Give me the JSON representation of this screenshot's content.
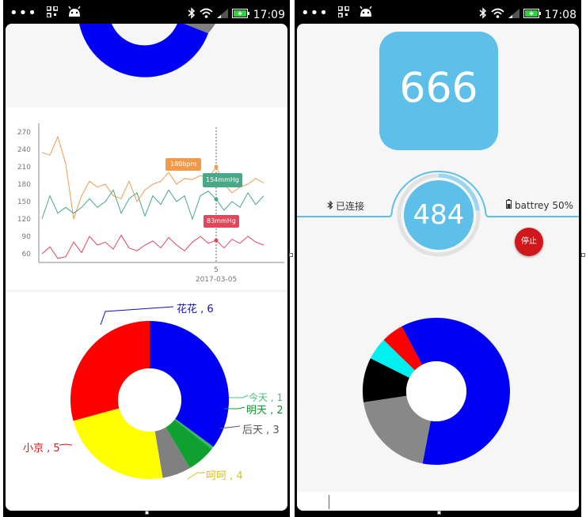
{
  "left_phone": {
    "status": {
      "time": "17:09"
    },
    "line_chart": {
      "y_ticks": [
        "270",
        "240",
        "210",
        "180",
        "150",
        "120",
        "90",
        "60"
      ],
      "x_tick": "5",
      "x_date": "2017-03-05",
      "markers": [
        {
          "label": "180bpm",
          "color": "#f29a4c"
        },
        {
          "label": "154mmHg",
          "color": "#4aa88a"
        },
        {
          "label": "83mmHg",
          "color": "#e0495a"
        }
      ]
    },
    "pie_labels": [
      {
        "text": "花花 , 6",
        "color": "#1010c0"
      },
      {
        "text": "今天 , 1",
        "color": "#3dc47c"
      },
      {
        "text": "明天 , 2",
        "color": "#0a9a2a"
      },
      {
        "text": "后天 , 3",
        "color": "#555555"
      },
      {
        "text": "呵呵 , 4",
        "color": "#d6c21c"
      },
      {
        "text": "小京 , 5",
        "color": "#e01010"
      }
    ]
  },
  "right_phone": {
    "status": {
      "time": "17:08"
    },
    "big_value": "666",
    "gauge_value": "484",
    "connection_text": "已连接",
    "battery_text": "battrey 50%",
    "stop_label": "停止"
  },
  "chart_data": [
    {
      "type": "line",
      "x_tick_labels": [
        "5"
      ],
      "x_date_label": "2017-03-05",
      "ylim": [
        45,
        285
      ],
      "y_ticks": [
        60,
        90,
        120,
        150,
        180,
        210,
        240,
        270
      ],
      "grid": false,
      "series": [
        {
          "color": "#f29a4c",
          "values": [
            235,
            230,
            262,
            215,
            120,
            160,
            185,
            175,
            180,
            160,
            155,
            185,
            150,
            170,
            180,
            185,
            200,
            180,
            190,
            188,
            195,
            190,
            210,
            180,
            165,
            175,
            180,
            190,
            182
          ]
        },
        {
          "color": "#4aa88a",
          "values": [
            120,
            160,
            130,
            140,
            130,
            140,
            155,
            140,
            150,
            170,
            130,
            155,
            165,
            125,
            160,
            145,
            170,
            150,
            160,
            120,
            160,
            168,
            154,
            135,
            150,
            140,
            165,
            145,
            160
          ]
        },
        {
          "color": "#e0495a",
          "values": [
            60,
            72,
            52,
            55,
            80,
            62,
            90,
            75,
            80,
            68,
            92,
            70,
            65,
            75,
            82,
            70,
            88,
            75,
            65,
            80,
            90,
            78,
            83,
            70,
            85,
            78,
            90,
            80,
            75
          ]
        }
      ],
      "highlight_index": 22
    },
    {
      "type": "pie",
      "labels": [
        "花花 , 6",
        "今天 , 1",
        "明天 , 2",
        "后天 , 3",
        "呵呵 , 4",
        "小京 , 5"
      ],
      "values": [
        6,
        0.1,
        1,
        1,
        4,
        5
      ],
      "colors": [
        "#0000f5",
        "#38b86a",
        "#10a030",
        "#808080",
        "#ffff00",
        "#ff0000"
      ]
    },
    {
      "type": "pie",
      "labels": [],
      "values": [
        62,
        20,
        10,
        5,
        5
      ],
      "colors": [
        "#0000f5",
        "#888888",
        "#000000",
        "#00f0f0",
        "#ff0000"
      ]
    }
  ]
}
